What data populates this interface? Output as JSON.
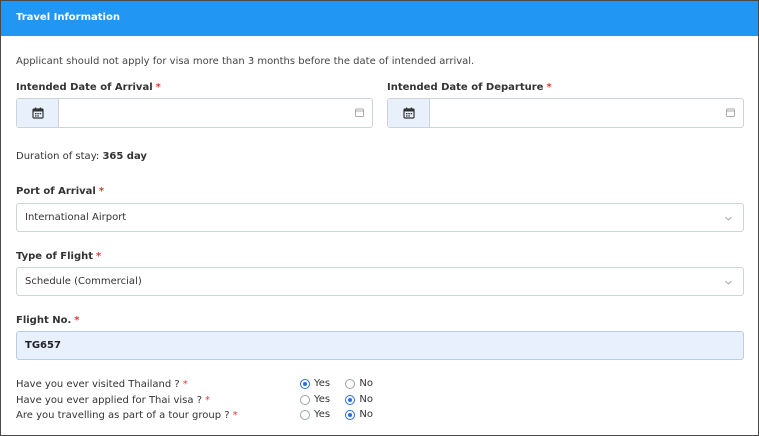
{
  "panel": {
    "title": "Travel Information"
  },
  "notice": "Applicant should not apply for visa more than 3 months before the date of intended arrival.",
  "required_mark": "*",
  "arrival": {
    "label": "Intended Date of Arrival",
    "value": ""
  },
  "departure": {
    "label": "Intended Date of Departure",
    "value": ""
  },
  "duration": {
    "label": "Duration of stay:",
    "value": "365 day"
  },
  "port": {
    "label": "Port of Arrival",
    "value": "International Airport"
  },
  "flight_type": {
    "label": "Type of Flight",
    "value": "Schedule (Commercial)"
  },
  "flight_no": {
    "label": "Flight No.",
    "value": "TG657"
  },
  "questions": [
    {
      "text": "Have you ever visited Thailand ?",
      "yes": "Yes",
      "no": "No",
      "selected": "yes"
    },
    {
      "text": "Have you ever applied for Thai visa ?",
      "yes": "Yes",
      "no": "No",
      "selected": "no"
    },
    {
      "text": "Are you travelling as part of a tour group ?",
      "yes": "Yes",
      "no": "No",
      "selected": "no"
    }
  ],
  "colors": {
    "header": "#2196f3",
    "required": "#e53935",
    "radio": "#2a6fdb",
    "input_fill": "#e8f0fe"
  }
}
